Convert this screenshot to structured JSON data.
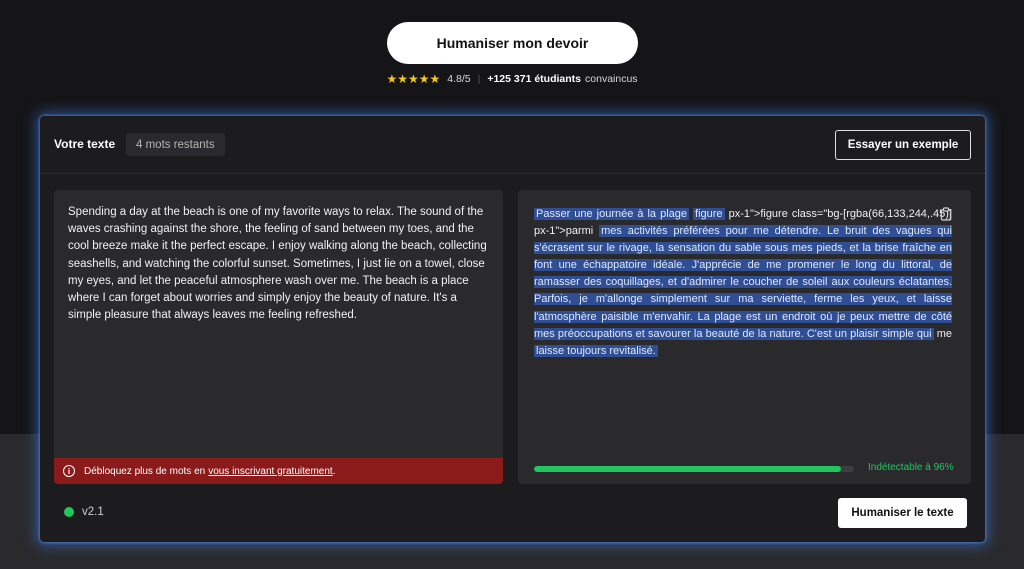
{
  "top_button": {
    "label": "Humaniser mon devoir"
  },
  "rating": {
    "stars": "★★★★★",
    "score": "4.8/5",
    "students_count": "+125 371 étudiants",
    "students_suffix": "convaincus"
  },
  "header": {
    "title": "Votre texte",
    "words_left": "4 mots restants",
    "example_button": "Essayer un exemple"
  },
  "input_text": "Spending a day at the beach is one of my favorite ways to relax. The sound of the waves crashing against the shore, the feeling of sand between my toes, and the cool breeze make it the perfect escape. I enjoy walking along the beach, collecting seashells, and watching the colorful sunset. Sometimes, I just lie on a towel, close my eyes, and let the peaceful atmosphere wash over me. The beach is a place where I can forget about worries and simply enjoy the beauty of nature. It's a simple pleasure that always leaves me feeling refreshed.",
  "warning": {
    "text": "Débloquez plus de mots en",
    "link": "vous inscrivant gratuitement",
    "end": "."
  },
  "output": {
    "segments": [
      {
        "text": "Passer une journée à la plage",
        "hl": true
      },
      {
        "text": " ",
        "hl": false
      },
      {
        "text": "figure",
        "hl": true
      },
      {
        "text": " px-1\">figure class=\"bg-[rgba(66,133,244,.45)] px-1\">parmi ",
        "hl": false
      },
      {
        "text": "mes activités préférées pour me détendre. Le bruit des vagues qui s'écrasent sur le rivage, la sensation du sable sous mes pieds, et la brise fraîche en font une échappatoire idéale. J'apprécie de me promener le long du littoral, de ramasser des coquillages, et d'admirer le coucher de soleil aux couleurs éclatantes. Parfois, je m'allonge simplement sur ma serviette, ferme les yeux, et laisse l'atmosphère paisible m'envahir. La plage est un endroit où je peux mettre de côté mes préoccupations et savourer la beauté de la nature. C'est un plaisir simple qui",
        "hl": true
      },
      {
        "text": " me ",
        "hl": false
      },
      {
        "text": "laisse toujours revitalisé.",
        "hl": true
      }
    ],
    "progress": 0.96,
    "progress_label": "Indétectable à 96%"
  },
  "version": "v2.1",
  "humanize_button": "Humaniser le texte",
  "colors": {
    "accent_glow": "#4285f4",
    "highlight": "#2f4e93",
    "success": "#22c55e",
    "warning_bg": "#8b1a1a"
  }
}
